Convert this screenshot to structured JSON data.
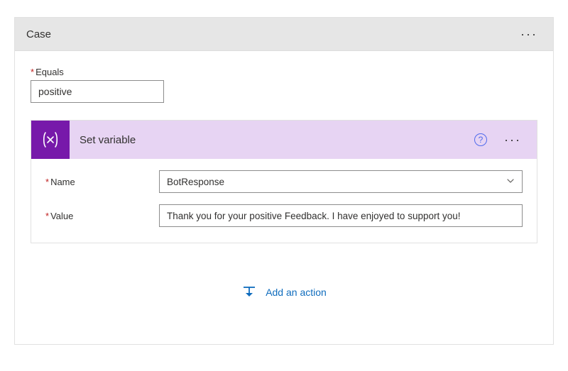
{
  "case": {
    "header_title": "Case",
    "equals_label": "Equals",
    "equals_value": "positive"
  },
  "set_variable": {
    "title": "Set variable",
    "name_label": "Name",
    "name_value": "BotResponse",
    "value_label": "Value",
    "value_value": "Thank you for your positive Feedback. I have enjoyed to support you!"
  },
  "add_action_label": "Add an action"
}
